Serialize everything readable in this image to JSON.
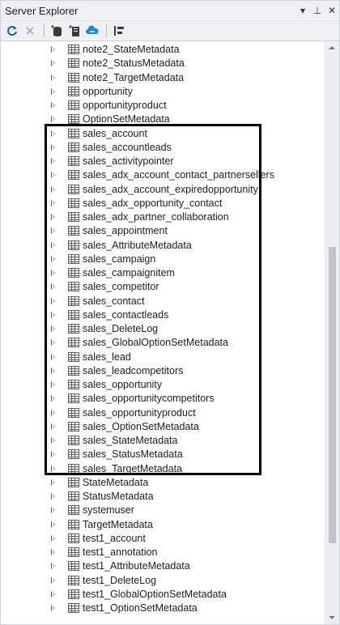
{
  "window": {
    "title": "Server Explorer",
    "menu_glyph": "▾",
    "pin_glyph": "⊥",
    "close_glyph": "✕"
  },
  "toolbar": {
    "buttons": [
      "refresh-icon",
      "stop-icon",
      "connect-database-icon",
      "connect-server-icon",
      "connect-azure-icon",
      "properties-icon"
    ]
  },
  "tree": {
    "items": [
      "note2_StateMetadata",
      "note2_StatusMetadata",
      "note2_TargetMetadata",
      "opportunity",
      "opportunityproduct",
      "OptionSetMetadata",
      "sales_account",
      "sales_accountleads",
      "sales_activitypointer",
      "sales_adx_account_contact_partnersellers",
      "sales_adx_account_expiredopportunity",
      "sales_adx_opportunity_contact",
      "sales_adx_partner_collaboration",
      "sales_appointment",
      "sales_AttributeMetadata",
      "sales_campaign",
      "sales_campaignitem",
      "sales_competitor",
      "sales_contact",
      "sales_contactleads",
      "sales_DeleteLog",
      "sales_GlobalOptionSetMetadata",
      "sales_lead",
      "sales_leadcompetitors",
      "sales_opportunity",
      "sales_opportunitycompetitors",
      "sales_opportunityproduct",
      "sales_OptionSetMetadata",
      "sales_StateMetadata",
      "sales_StatusMetadata",
      "sales_TargetMetadata",
      "StateMetadata",
      "StatusMetadata",
      "systemuser",
      "TargetMetadata",
      "test1_account",
      "test1_annotation",
      "test1_AttributeMetadata",
      "test1_DeleteLog",
      "test1_GlobalOptionSetMetadata",
      "test1_OptionSetMetadata"
    ]
  },
  "colors": {
    "chrome": "#eef0f4",
    "highlight_border": "#000000",
    "scroll_thumb": "#c2c3c9"
  }
}
